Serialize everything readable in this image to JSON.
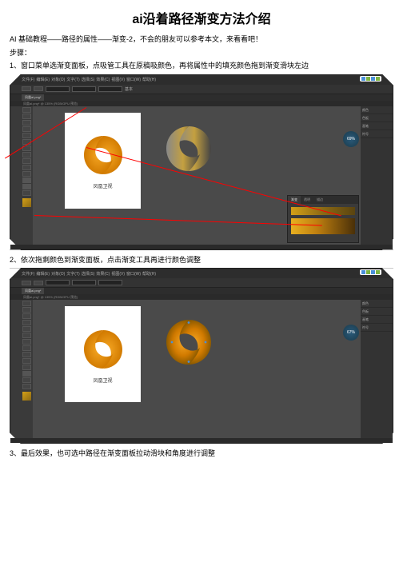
{
  "title": "ai沿着路径渐变方法介绍",
  "intro": "AI 基础教程——路径的属性——渐变-2，不会的朋友可以参考本文，来看看吧！",
  "steps_label": "步骤：",
  "steps": [
    "1、窗口菜单选渐变面板，点吸管工具在原稿吸颜色，再将属性中的填充颜色拖到渐变滑块左边",
    "2、依次拖剩颜色到渐变面板，点击渐变工具再进行颜色调整",
    "3、最后效果，也可选中路径在渐变面板拉动滑块和角度进行调整"
  ],
  "menubar": [
    "文件(F)",
    "编辑(E)",
    "对象(O)",
    "文字(T)",
    "选择(S)",
    "效果(C)",
    "视图(V)",
    "窗口(W)",
    "帮助(H)"
  ],
  "tab_name": "凤凰ai.png*",
  "zoom_info": "凤凰ai.png* @ 135% (RGB/GPU 预览)",
  "artboard_caption": "凤凰卫视",
  "gpu_pct_1": "69%",
  "gpu_pct_2": "67%",
  "grad_panel_tabs": [
    "渐变",
    "透明",
    "描边"
  ],
  "ribbon_label": "基本",
  "rpanel_items": [
    "颜色",
    "色板",
    "画笔",
    "符号"
  ],
  "icons": {
    "selection": "selection-tool-icon",
    "direct": "direct-select-icon",
    "pen": "pen-tool-icon",
    "type": "type-tool-icon",
    "line": "line-tool-icon",
    "shape": "rect-tool-icon",
    "brush": "brush-tool-icon",
    "pencil": "pencil-tool-icon",
    "eraser": "eraser-tool-icon",
    "rotate": "rotate-tool-icon",
    "scale": "scale-tool-icon",
    "gradient": "gradient-tool-icon",
    "eyedropper": "eyedropper-tool-icon",
    "zoom": "zoom-tool-icon"
  }
}
